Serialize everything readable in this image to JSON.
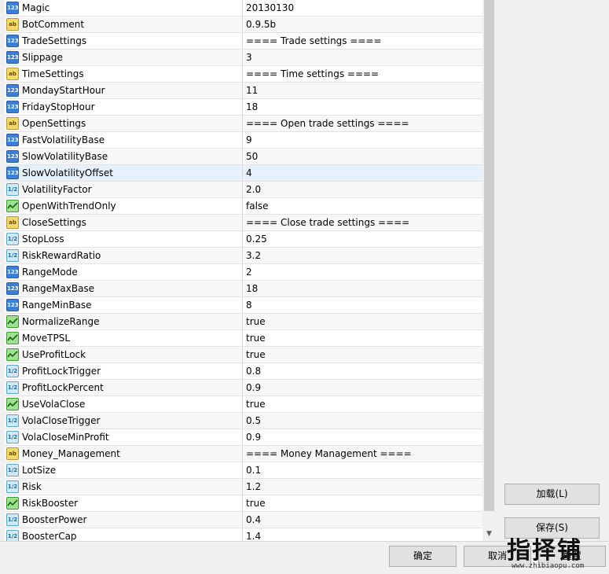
{
  "params": [
    {
      "type": "int",
      "name": "Magic",
      "value": "20130130"
    },
    {
      "type": "string",
      "name": "BotComment",
      "value": "0.9.5b"
    },
    {
      "type": "int",
      "name": "TradeSettings",
      "value": "==== Trade settings ===="
    },
    {
      "type": "int",
      "name": "Slippage",
      "value": "3"
    },
    {
      "type": "string",
      "name": "TimeSettings",
      "value": "==== Time settings ===="
    },
    {
      "type": "int",
      "name": "MondayStartHour",
      "value": "11"
    },
    {
      "type": "int",
      "name": "FridayStopHour",
      "value": "18"
    },
    {
      "type": "string",
      "name": "OpenSettings",
      "value": "==== Open trade settings ===="
    },
    {
      "type": "int",
      "name": "FastVolatilityBase",
      "value": "9"
    },
    {
      "type": "int",
      "name": "SlowVolatilityBase",
      "value": "50"
    },
    {
      "type": "int",
      "name": "SlowVolatilityOffset",
      "value": "4",
      "selected": true
    },
    {
      "type": "double",
      "name": "VolatilityFactor",
      "value": "2.0"
    },
    {
      "type": "bool",
      "name": "OpenWithTrendOnly",
      "value": "false"
    },
    {
      "type": "string",
      "name": "CloseSettings",
      "value": "==== Close trade settings ===="
    },
    {
      "type": "double",
      "name": "StopLoss",
      "value": "0.25"
    },
    {
      "type": "double",
      "name": "RiskRewardRatio",
      "value": "3.2"
    },
    {
      "type": "int",
      "name": "RangeMode",
      "value": "2"
    },
    {
      "type": "int",
      "name": "RangeMaxBase",
      "value": "18"
    },
    {
      "type": "int",
      "name": "RangeMinBase",
      "value": "8"
    },
    {
      "type": "bool",
      "name": "NormalizeRange",
      "value": "true"
    },
    {
      "type": "bool",
      "name": "MoveTPSL",
      "value": "true"
    },
    {
      "type": "bool",
      "name": "UseProfitLock",
      "value": "true"
    },
    {
      "type": "double",
      "name": "ProfitLockTrigger",
      "value": "0.8"
    },
    {
      "type": "double",
      "name": "ProfitLockPercent",
      "value": "0.9"
    },
    {
      "type": "bool",
      "name": "UseVolaClose",
      "value": "true"
    },
    {
      "type": "double",
      "name": "VolaCloseTrigger",
      "value": "0.5"
    },
    {
      "type": "double",
      "name": "VolaCloseMinProfit",
      "value": "0.9"
    },
    {
      "type": "string",
      "name": "Money_Management",
      "value": "==== Money Management ===="
    },
    {
      "type": "double",
      "name": "LotSize",
      "value": "0.1"
    },
    {
      "type": "double",
      "name": "Risk",
      "value": "1.2"
    },
    {
      "type": "bool",
      "name": "RiskBooster",
      "value": "true"
    },
    {
      "type": "double",
      "name": "BoosterPower",
      "value": "0.4"
    },
    {
      "type": "double",
      "name": "BoosterCap",
      "value": "1.4"
    }
  ],
  "icon_glyphs": {
    "int": "123",
    "string": "ab",
    "double": "1/2",
    "bool": ""
  },
  "icon_names": {
    "int": "integer-type-icon",
    "string": "string-type-icon",
    "double": "double-type-icon",
    "bool": "boolean-type-icon"
  },
  "buttons": {
    "load": "加载(L)",
    "save": "保存(S)",
    "ok": "确定",
    "cancel": "取消",
    "reset": "重置"
  },
  "watermark": {
    "text": "指择铺",
    "url": "www.zhibiaopu.com"
  },
  "colors": {
    "selected_row": "#e6f1fb",
    "int_icon": "#3d7fd6",
    "string_icon": "#f2d96b",
    "double_icon": "#cfe9f7",
    "bool_icon": "#9fe093"
  }
}
